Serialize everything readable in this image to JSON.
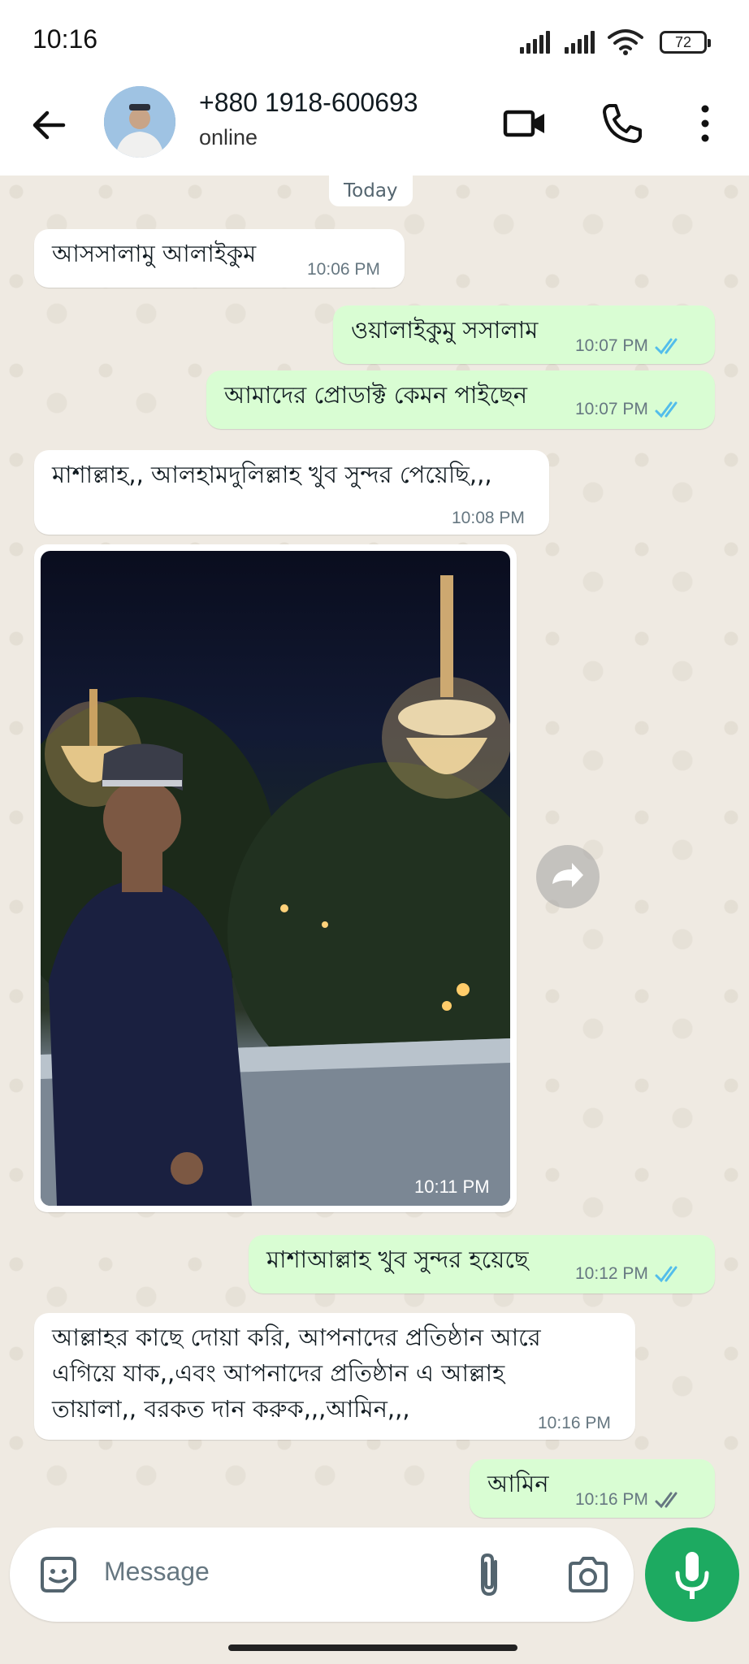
{
  "status_bar": {
    "time": "10:16",
    "battery": "72"
  },
  "header": {
    "contact_name": "+880 1918-600693",
    "contact_status": "online"
  },
  "chat": {
    "date_label": "Today",
    "messages": [
      {
        "direction": "in",
        "text": "আসসালামু আলাইকুম",
        "time": "10:06 PM"
      },
      {
        "direction": "out",
        "text": "ওয়ালাইকুমু সসালাম",
        "time": "10:07 PM",
        "status": "read"
      },
      {
        "direction": "out",
        "text": "আমাদের প্রোডাক্ট কেমন পাইছেন",
        "time": "10:07 PM",
        "status": "read"
      },
      {
        "direction": "in",
        "text": "মাশাল্লাহ,, আলহামদুলিল্লাহ খুব সুন্দর পেয়েছি,,,",
        "time": "10:08 PM"
      },
      {
        "direction": "in",
        "type": "image",
        "time": "10:11 PM"
      },
      {
        "direction": "out",
        "text": "মাশাআল্লাহ খুব সুন্দর হয়েছে",
        "time": "10:12 PM",
        "status": "read"
      },
      {
        "direction": "in",
        "lines": [
          "আল্লাহর কাছে দোয়া করি, আপনাদের প্রতিষ্ঠান আরে",
          "এগিয়ে যাক,,এবং আপনাদের প্রতিষ্ঠান এ আল্লাহ",
          "তায়ালা,, বরকত দান করুক,,,আমিন,,,"
        ],
        "time": "10:16 PM"
      },
      {
        "direction": "out",
        "text": "আমিন",
        "time": "10:16 PM",
        "status": "delivered"
      }
    ]
  },
  "input": {
    "placeholder": "Message"
  },
  "colors": {
    "read_tick": "#53bdeb",
    "delivered_tick": "#667781",
    "outgoing_bubble": "#d9fdd3",
    "incoming_bubble": "#ffffff",
    "mic_button": "#1daa61"
  },
  "icons": {
    "back": "arrow-left-icon",
    "video": "video-camera-icon",
    "call": "phone-icon",
    "menu": "more-vertical-icon",
    "sticker": "sticker-icon",
    "attach": "paperclip-icon",
    "camera": "camera-icon",
    "mic": "microphone-icon",
    "forward": "forward-icon"
  }
}
